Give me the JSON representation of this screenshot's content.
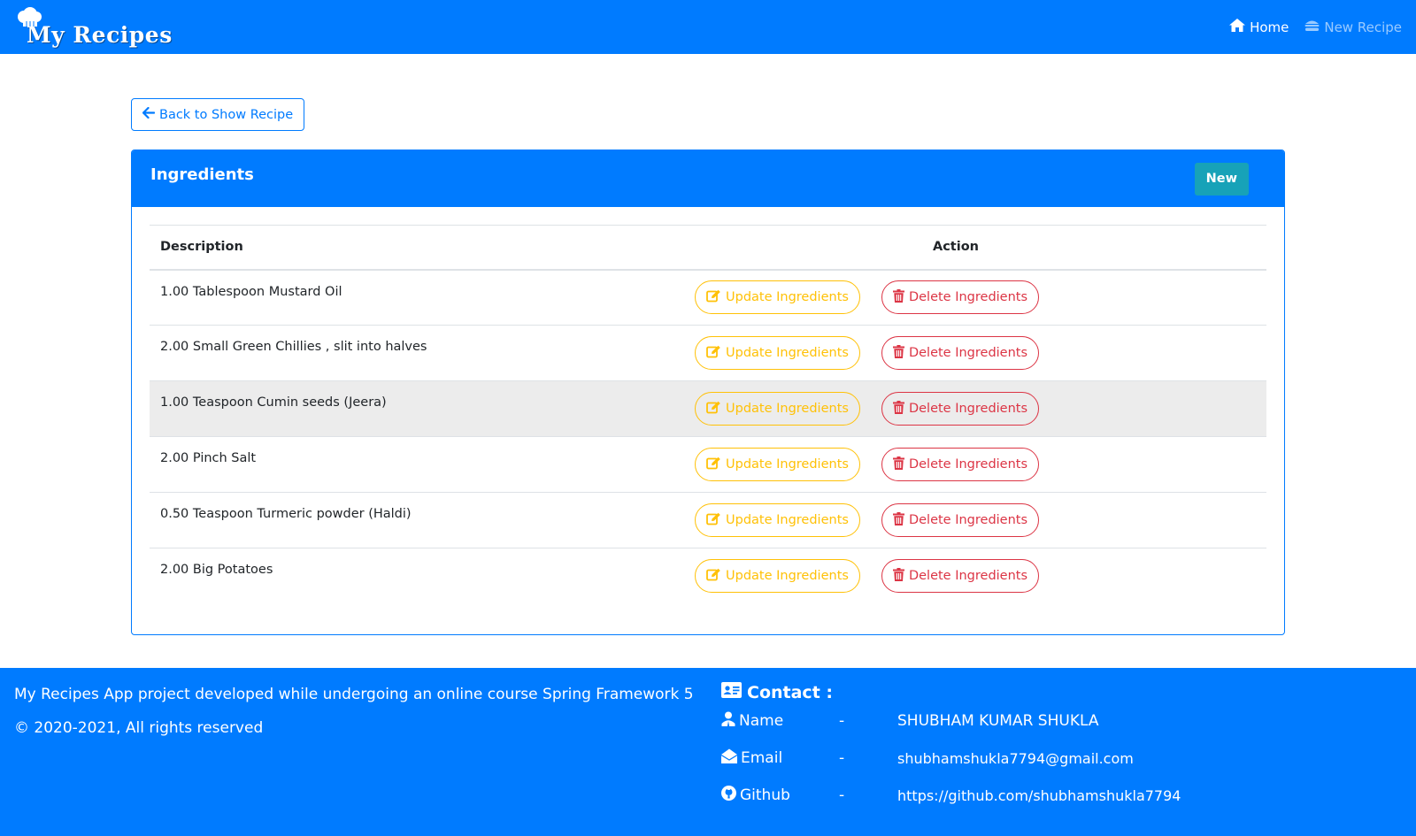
{
  "navbar": {
    "brand": "My Recipes",
    "links": [
      {
        "label": "Home",
        "icon": "home-icon",
        "active": true
      },
      {
        "label": "New Recipe",
        "icon": "burger-icon",
        "active": false
      }
    ]
  },
  "back_button": {
    "label": "Back to Show Recipe",
    "icon": "arrow-left-icon"
  },
  "card": {
    "title": "Ingredients",
    "new_label": "New",
    "columns": [
      "Description",
      "Action"
    ],
    "rows": [
      {
        "description": "1.00 Tablespoon Mustard Oil"
      },
      {
        "description": "2.00 Small Green Chillies , slit into halves"
      },
      {
        "description": "1.00 Teaspoon Cumin seeds (Jeera)"
      },
      {
        "description": "2.00 Pinch Salt"
      },
      {
        "description": "0.50 Teaspoon Turmeric powder (Haldi)"
      },
      {
        "description": "2.00 Big Potatoes"
      }
    ],
    "update_label": "Update Ingredients",
    "delete_label": "Delete Ingredients"
  },
  "footer": {
    "about": "My Recipes App project developed while undergoing an online course Spring Framework 5",
    "copyright": "© 2020-2021, All rights reserved",
    "contact_title": "Contact :",
    "contacts": [
      {
        "label": "Name",
        "dash": "-",
        "value": "SHUBHAM KUMAR SHUKLA"
      },
      {
        "label": "Email",
        "dash": "-",
        "value": "shubhamshukla7794@gmail.com"
      },
      {
        "label": "Github",
        "dash": "-",
        "value": "https://github.com/shubhamshukla7794"
      }
    ]
  },
  "colors": {
    "primary": "#007bff",
    "info": "#17a2b8",
    "warning": "#ffc107",
    "danger": "#dc3545"
  }
}
